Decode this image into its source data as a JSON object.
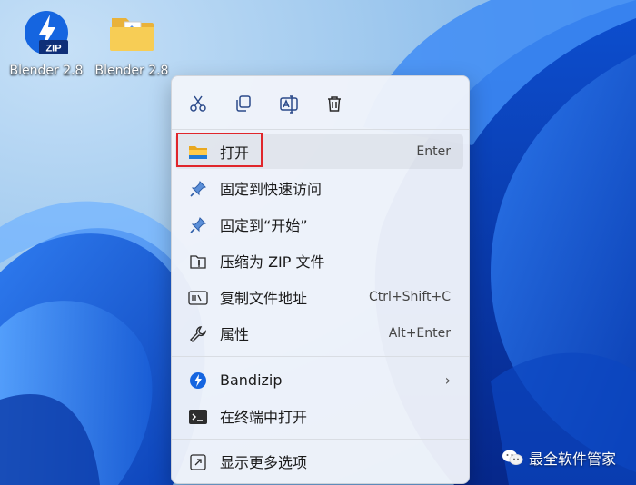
{
  "desktop": {
    "icons": [
      {
        "label": "Blender 2.8",
        "kind": "zip-file",
        "badge": "ZIP"
      },
      {
        "label": "Blender 2.8",
        "kind": "folder"
      }
    ]
  },
  "context_menu": {
    "toolbar": [
      {
        "name": "cut",
        "icon": "scissors-icon"
      },
      {
        "name": "copy",
        "icon": "copy-icon"
      },
      {
        "name": "rename",
        "icon": "rename-icon"
      },
      {
        "name": "delete",
        "icon": "trash-icon"
      }
    ],
    "items": [
      {
        "label": "打开",
        "shortcut": "Enter",
        "icon": "folder-icon"
      },
      {
        "label": "固定到快速访问",
        "icon": "pin-icon"
      },
      {
        "label": "固定到“开始”",
        "icon": "pin-icon"
      },
      {
        "label": "压缩为 ZIP 文件",
        "icon": "zip-archive-icon"
      },
      {
        "label": "复制文件地址",
        "shortcut": "Ctrl+Shift+C",
        "icon": "copy-path-icon"
      },
      {
        "label": "属性",
        "shortcut": "Alt+Enter",
        "icon": "wrench-icon"
      },
      {
        "label": "Bandizip",
        "submenu": "›",
        "icon": "bandizip-icon"
      },
      {
        "label": "在终端中打开",
        "icon": "terminal-icon"
      },
      {
        "label": "显示更多选项",
        "icon": "more-options-icon"
      }
    ],
    "highlighted_item": "打开"
  },
  "watermark": {
    "text": "最全软件管家",
    "icon": "wechat-icon"
  },
  "colors": {
    "highlight_border": "#e0262b",
    "accent": "#0b5cd5"
  }
}
